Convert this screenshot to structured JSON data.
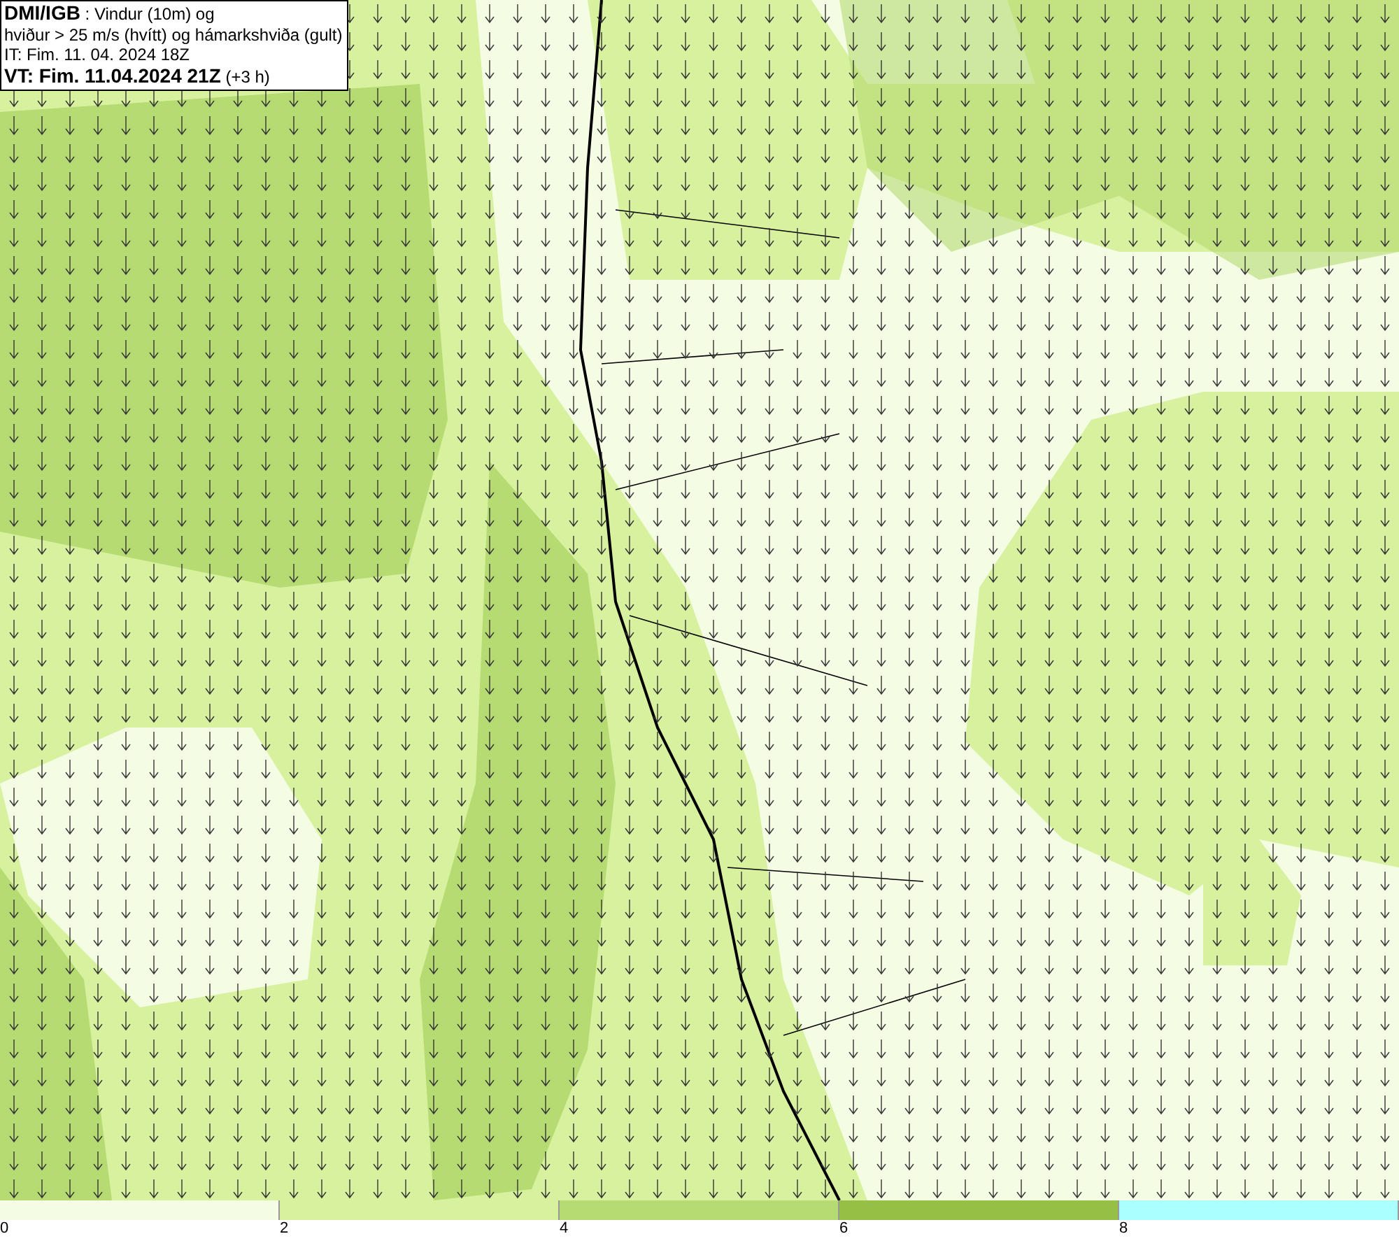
{
  "title_box": {
    "lines": [
      "**DMI/IGB** : Vindur (10m) og",
      "hviður > 25 m/s (hvítt) og hámarkshviða (gult)",
      "IT: Fim. 11. 04. 2024 18Z",
      "**VT: Fim. 11.04.2024 21Z** (+3 h)"
    ]
  },
  "legend": [
    {
      "label": "0",
      "color": "#f4fce4"
    },
    {
      "label": "2",
      "color": "#d7f19e"
    },
    {
      "label": "4",
      "color": "#b6db72"
    },
    {
      "label": "6",
      "color": "#95bf45"
    },
    {
      "label": "8",
      "color": "#aaffff"
    }
  ]
}
